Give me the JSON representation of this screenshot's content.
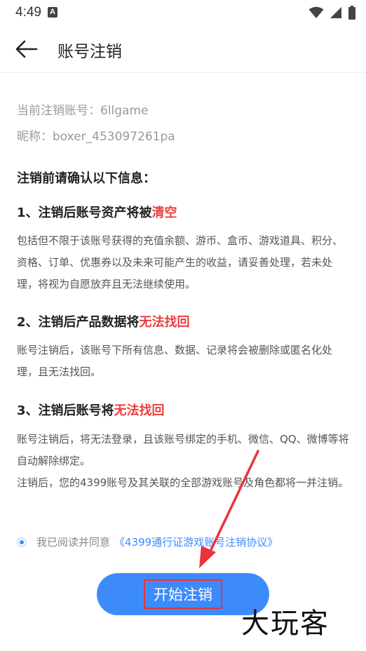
{
  "status_bar": {
    "time": "4:49",
    "notification_icon": "A"
  },
  "header": {
    "title": "账号注销"
  },
  "account": {
    "id_line": "当前注销账号：6llgame",
    "nickname_line": "昵称：boxer_453097261pa"
  },
  "confirm_heading": "注销前请确认以下信息：",
  "sections": [
    {
      "title_prefix": "1、注销后账号资产将被",
      "title_highlight": "清空",
      "body": "包括但不限于该账号获得的充值余额、游币、盒币、游戏道具、积分、资格、订单、优惠券以及未来可能产生的收益，请妥善处理，若未处理，将视为自愿放弃且无法继续使用。"
    },
    {
      "title_prefix": "2、注销后产品数据将",
      "title_highlight": "无法找回",
      "body": "账号注销后，该账号下所有信息、数据、记录将会被删除或匿名化处理，且无法找回。"
    },
    {
      "title_prefix": "3、注销后账号将",
      "title_highlight": "无法找回",
      "body_1": "账号注销后，将无法登录，且该账号绑定的手机、微信、QQ、微博等将自动解除绑定。",
      "body_2": "注销后，您的4399账号及其关联的全部游戏账号及角色都将一并注销。"
    }
  ],
  "agreement": {
    "text": "我已阅读并同意",
    "link": "《4399通行证游戏账号注销协议》"
  },
  "start_button": {
    "label": "开始注销"
  },
  "watermark": "大玩客",
  "colors": {
    "accent": "#3d8bfb",
    "highlight": "#f03c3c",
    "annotation": "#e8343c"
  }
}
